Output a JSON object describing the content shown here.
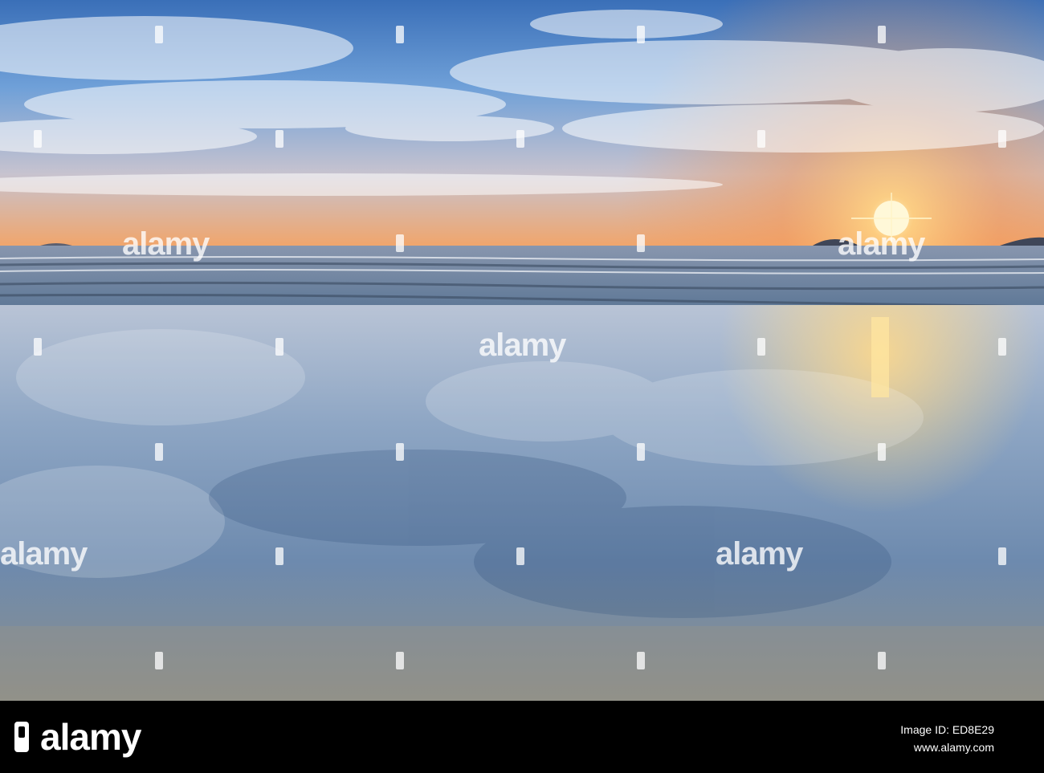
{
  "watermark": {
    "word": "alamy",
    "color": "#ffffff"
  },
  "footer": {
    "logo": "alamy",
    "image_id": "Image ID: ED8E29",
    "url": "www.alamy.com"
  },
  "scene": {
    "sky_top": "#3f7fc9",
    "sky_horizon": "#f0a060",
    "sun": "#fff4c0",
    "water": "#6f8fb3"
  }
}
